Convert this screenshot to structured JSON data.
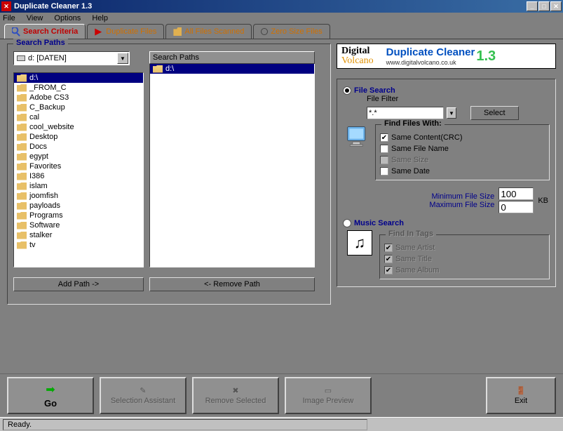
{
  "title": "Duplicate Cleaner 1.3",
  "menubar": [
    "File",
    "View",
    "Options",
    "Help"
  ],
  "tabs": [
    {
      "label": "Search Criteria"
    },
    {
      "label": "Duplicate Files"
    },
    {
      "label": "All Files Scanned"
    },
    {
      "label": "Zero Size Files"
    }
  ],
  "searchPaths": {
    "legend": "Search Paths",
    "driveCombo": "d: [DATEN]",
    "folders": [
      "d:\\",
      "_FROM_C",
      "Adobe CS3",
      "C_Backup",
      "cal",
      "cool_website",
      "Desktop",
      "Docs",
      "egypt",
      "Favorites",
      "I386",
      "islam",
      "joomfish",
      "payloads",
      "Programs",
      "Software",
      "stalker",
      "tv"
    ],
    "rightHeader": "Search Paths",
    "rightItems": [
      "d:\\"
    ],
    "addBtn": "Add Path ->",
    "removeBtn": "<- Remove Path"
  },
  "banner": {
    "digital": "Digital",
    "volcano": "Volcano",
    "title": "Duplicate Cleaner",
    "url": "www.digitalvolcano.co.uk",
    "ver": "1.3"
  },
  "fileSearch": {
    "label": "File Search",
    "filterLabel": "File Filter",
    "filterValue": "*.*",
    "selectBtn": "Select",
    "findLabel": "Find Files With:",
    "sameContent": "Same Content(CRC)",
    "sameName": "Same File Name",
    "sameSize": "Same Size",
    "sameDate": "Same Date",
    "minLabel": "Minimum File Size",
    "maxLabel": "Maximum File Size",
    "minVal": "100",
    "maxVal": "0",
    "kb": "KB"
  },
  "musicSearch": {
    "label": "Music Search",
    "findInTags": "Find In Tags",
    "sameArtist": "Same Artist",
    "sameTitle": "Same Title",
    "sameAlbum": "Same Album"
  },
  "bottom": {
    "go": "Go",
    "sel": "Selection Assistant",
    "rem": "Remove Selected",
    "prev": "Image Preview",
    "exit": "Exit"
  },
  "status": "Ready."
}
